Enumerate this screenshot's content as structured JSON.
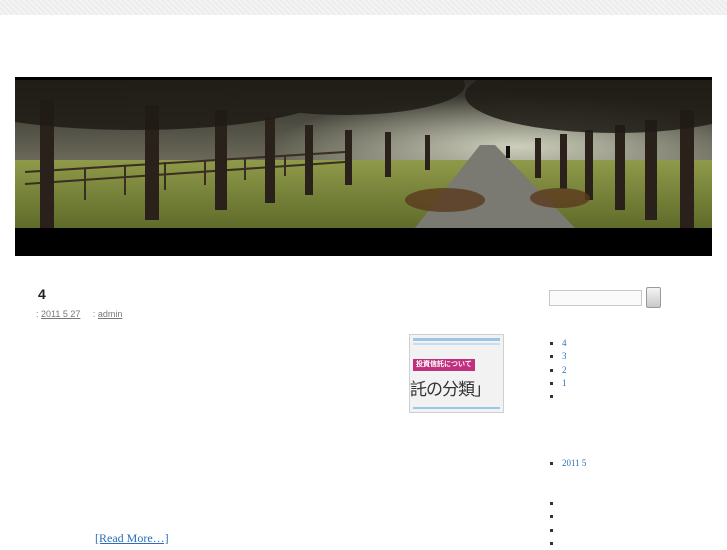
{
  "post": {
    "title": "4",
    "meta_prefix1": ": ",
    "date": "2011 5 27",
    "meta_prefix2": ": ",
    "author": "admin",
    "read_more": "[Read More…]",
    "thumbnail": {
      "tag": "投資信託について",
      "headline": "託の分類」"
    }
  },
  "sidebar": {
    "recent_posts": [
      "4",
      "3",
      "2",
      "1",
      ""
    ],
    "archives": [
      "2011 5"
    ],
    "other_items": [
      "",
      "",
      "",
      ""
    ]
  }
}
